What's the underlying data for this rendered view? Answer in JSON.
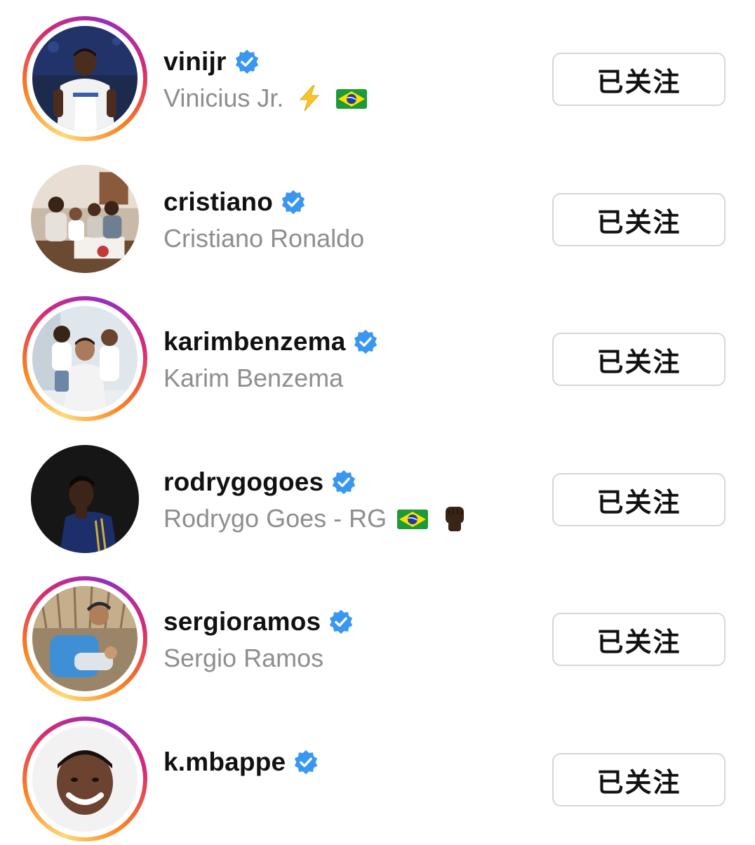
{
  "following": [
    {
      "username": "vinijr",
      "full_name": "Vinicius Jr.",
      "verified": true,
      "has_story": true,
      "emojis": [
        "lightning-emoji",
        "brazil-flag-emoji"
      ],
      "button_label": "已关注",
      "avatar": "vinijr-avatar"
    },
    {
      "username": "cristiano",
      "full_name": "Cristiano Ronaldo",
      "verified": true,
      "has_story": false,
      "emojis": [],
      "button_label": "已关注",
      "avatar": "cristiano-avatar"
    },
    {
      "username": "karimbenzema",
      "full_name": "Karim Benzema",
      "verified": true,
      "has_story": true,
      "emojis": [],
      "button_label": "已关注",
      "avatar": "karimbenzema-avatar"
    },
    {
      "username": "rodrygogoes",
      "full_name": "Rodrygo Goes - RG",
      "verified": true,
      "has_story": false,
      "emojis": [
        "brazil-flag-emoji",
        "raised-fist-emoji"
      ],
      "button_label": "已关注",
      "avatar": "rodrygogoes-avatar"
    },
    {
      "username": "sergioramos",
      "full_name": "Sergio Ramos",
      "verified": true,
      "has_story": true,
      "emojis": [],
      "button_label": "已关注",
      "avatar": "sergioramos-avatar"
    },
    {
      "username": "k.mbappe",
      "full_name": "",
      "verified": true,
      "has_story": true,
      "emojis": [],
      "button_label": "已关注",
      "avatar": "k-mbappe-avatar"
    }
  ],
  "colors": {
    "verified_blue": "#3897f0",
    "button_border": "#d6d6d6",
    "secondary_text": "#8e8e8e",
    "primary_text": "#111111"
  }
}
